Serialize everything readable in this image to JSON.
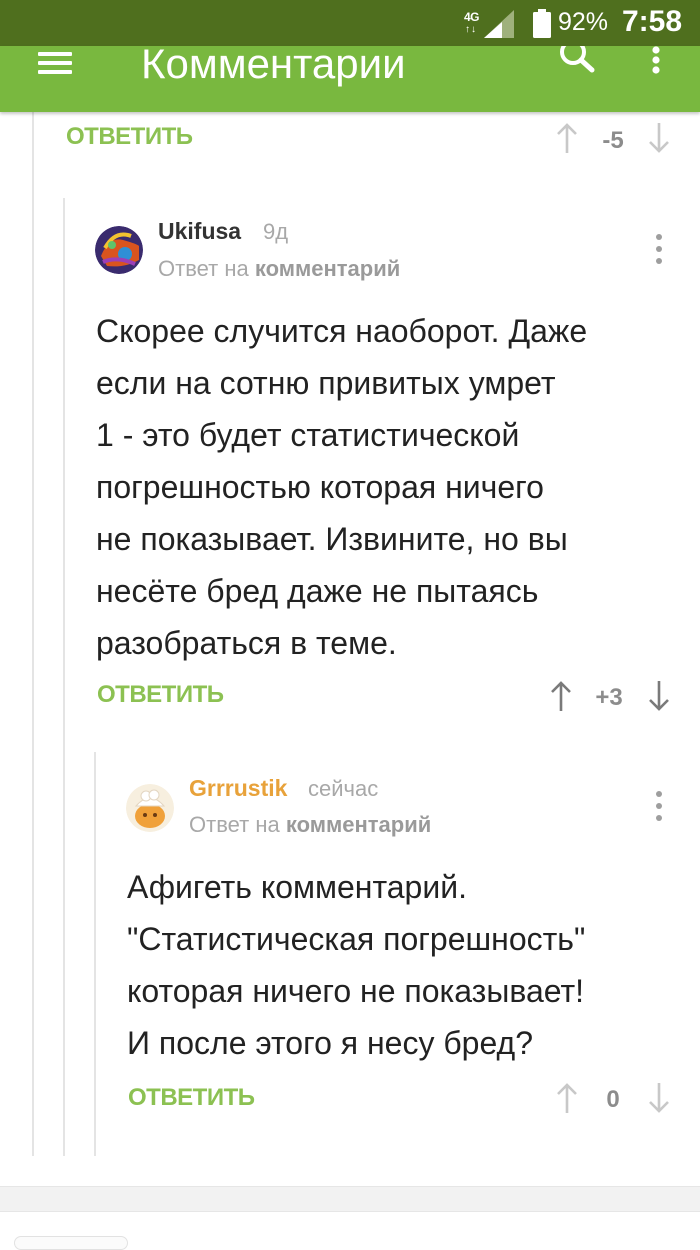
{
  "status_bar": {
    "network": "4G",
    "battery": "92%",
    "time": "7:58",
    "background": "#4f6f1e"
  },
  "app_bar": {
    "title": "Комментарии",
    "background": "#79b83f"
  },
  "colors": {
    "accent": "#8cc152",
    "author_orange": "#e8a23a"
  },
  "parent_comment": {
    "reply_label": "ОТВЕТИТЬ",
    "score": "-5"
  },
  "comments": [
    {
      "author": "Ukifusa",
      "time": "9д",
      "reply_prefix": "Ответ на",
      "reply_target": "комментарий",
      "text": "Скорее случится наоборот. Даже\nесли на сотню привитых умрет\n1 - это будет статистической\nпогрешностью которая ничего\nне показывает. Извините, но вы\nнесёте бред даже не пытаясь\nразобраться в теме.",
      "reply_label": "ОТВЕТИТЬ",
      "score": "+3"
    },
    {
      "author": "Grrrustik",
      "time": "сейчас",
      "reply_prefix": "Ответ на",
      "reply_target": "комментарий",
      "text": "Афигеть комментарий.\n\"Статистическая погрешность\"\nкоторая ничего не показывает!\nИ после этого я несу бред?",
      "reply_label": "ОТВЕТИТЬ",
      "score": "0"
    }
  ]
}
